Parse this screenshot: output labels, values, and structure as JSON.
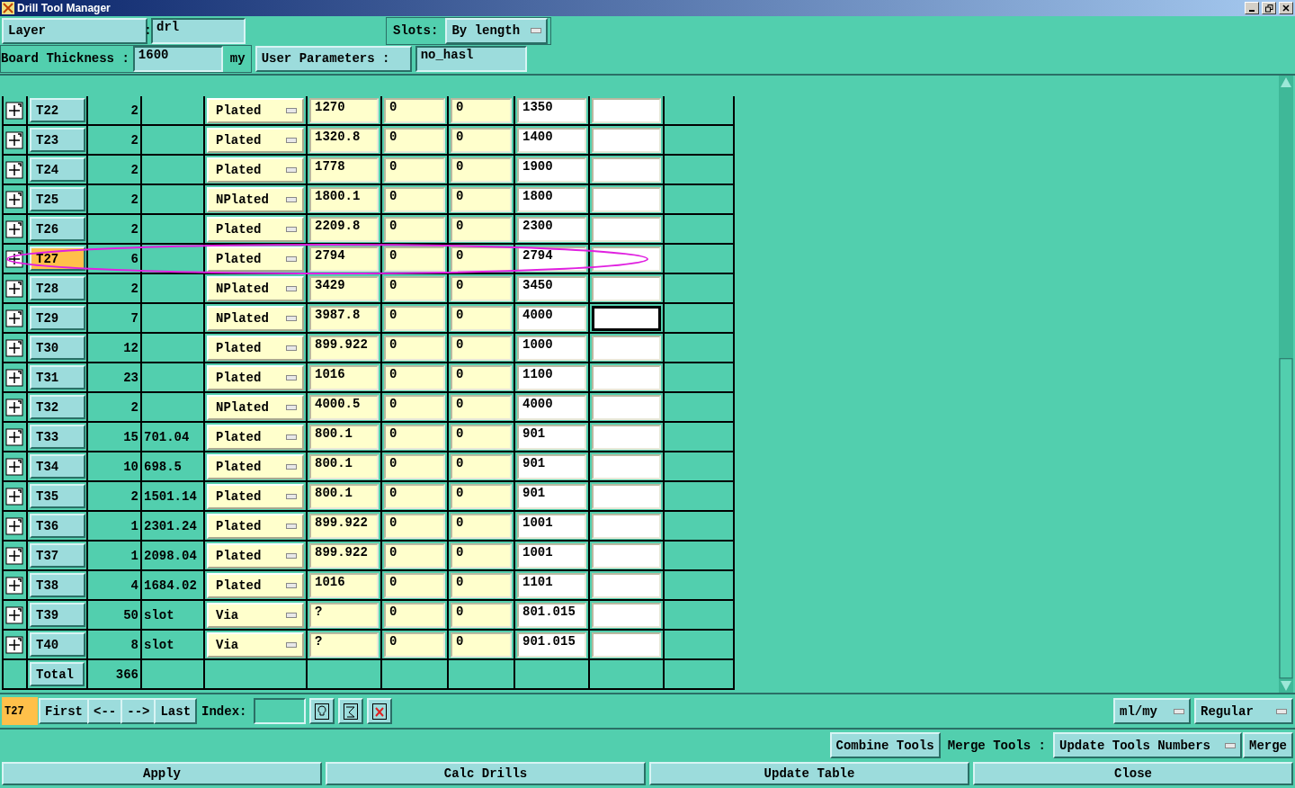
{
  "window": {
    "title": "Drill Tool Manager"
  },
  "header": {
    "layer_label": "Layer             :",
    "layer_value": "drl",
    "slots_label": "Slots:",
    "slots_value": "By length",
    "thickness_label": "Board Thickness :",
    "thickness_value": "1600",
    "thickness_unit": "my",
    "user_params_label": "User Parameters :",
    "user_params_value": "no_hasl"
  },
  "rows": [
    {
      "tool": "T22",
      "count": "2",
      "column_3": "",
      "type": "Plated",
      "column_5": "1270",
      "column_6": "0",
      "column_7": "0",
      "column_8": "1350",
      "selected": false,
      "focused": false,
      "circled": false
    },
    {
      "tool": "T23",
      "count": "2",
      "column_3": "",
      "type": "Plated",
      "column_5": "1320.8",
      "column_6": "0",
      "column_7": "0",
      "column_8": "1400",
      "selected": false,
      "focused": false,
      "circled": false
    },
    {
      "tool": "T24",
      "count": "2",
      "column_3": "",
      "type": "Plated",
      "column_5": "1778",
      "column_6": "0",
      "column_7": "0",
      "column_8": "1900",
      "selected": false,
      "focused": false,
      "circled": false
    },
    {
      "tool": "T25",
      "count": "2",
      "column_3": "",
      "type": "NPlated",
      "column_5": "1800.1",
      "column_6": "0",
      "column_7": "0",
      "column_8": "1800",
      "selected": false,
      "focused": false,
      "circled": false
    },
    {
      "tool": "T26",
      "count": "2",
      "column_3": "",
      "type": "Plated",
      "column_5": "2209.8",
      "column_6": "0",
      "column_7": "0",
      "column_8": "2300",
      "selected": false,
      "focused": false,
      "circled": false
    },
    {
      "tool": "T27",
      "count": "6",
      "column_3": "",
      "type": "Plated",
      "column_5": "2794",
      "column_6": "0",
      "column_7": "0",
      "column_8": "2794",
      "selected": true,
      "focused": false,
      "circled": true
    },
    {
      "tool": "T28",
      "count": "2",
      "column_3": "",
      "type": "NPlated",
      "column_5": "3429",
      "column_6": "0",
      "column_7": "0",
      "column_8": "3450",
      "selected": false,
      "focused": false,
      "circled": false
    },
    {
      "tool": "T29",
      "count": "7",
      "column_3": "",
      "type": "NPlated",
      "column_5": "3987.8",
      "column_6": "0",
      "column_7": "0",
      "column_8": "4000",
      "selected": false,
      "focused": true,
      "circled": false
    },
    {
      "tool": "T30",
      "count": "12",
      "column_3": "",
      "type": "Plated",
      "column_5": "899.922",
      "column_6": "0",
      "column_7": "0",
      "column_8": "1000",
      "selected": false,
      "focused": false,
      "circled": false
    },
    {
      "tool": "T31",
      "count": "23",
      "column_3": "",
      "type": "Plated",
      "column_5": "1016",
      "column_6": "0",
      "column_7": "0",
      "column_8": "1100",
      "selected": false,
      "focused": false,
      "circled": false
    },
    {
      "tool": "T32",
      "count": "2",
      "column_3": "",
      "type": "NPlated",
      "column_5": "4000.5",
      "column_6": "0",
      "column_7": "0",
      "column_8": "4000",
      "selected": false,
      "focused": false,
      "circled": false
    },
    {
      "tool": "T33",
      "count": "15",
      "column_3": "701.04",
      "type": "Plated",
      "column_5": "800.1",
      "column_6": "0",
      "column_7": "0",
      "column_8": "901",
      "selected": false,
      "focused": false,
      "circled": false
    },
    {
      "tool": "T34",
      "count": "10",
      "column_3": "698.5",
      "type": "Plated",
      "column_5": "800.1",
      "column_6": "0",
      "column_7": "0",
      "column_8": "901",
      "selected": false,
      "focused": false,
      "circled": false
    },
    {
      "tool": "T35",
      "count": "2",
      "column_3": "1501.14",
      "type": "Plated",
      "column_5": "800.1",
      "column_6": "0",
      "column_7": "0",
      "column_8": "901",
      "selected": false,
      "focused": false,
      "circled": false
    },
    {
      "tool": "T36",
      "count": "1",
      "column_3": "2301.24",
      "type": "Plated",
      "column_5": "899.922",
      "column_6": "0",
      "column_7": "0",
      "column_8": "1001",
      "selected": false,
      "focused": false,
      "circled": false
    },
    {
      "tool": "T37",
      "count": "1",
      "column_3": "2098.04",
      "type": "Plated",
      "column_5": "899.922",
      "column_6": "0",
      "column_7": "0",
      "column_8": "1001",
      "selected": false,
      "focused": false,
      "circled": false
    },
    {
      "tool": "T38",
      "count": "4",
      "column_3": "1684.02",
      "type": "Plated",
      "column_5": "1016",
      "column_6": "0",
      "column_7": "0",
      "column_8": "1101",
      "selected": false,
      "focused": false,
      "circled": false
    },
    {
      "tool": "T39",
      "count": "50",
      "column_3": "slot",
      "type": "Via",
      "column_5": "?",
      "column_6": "0",
      "column_7": "0",
      "column_8": "801.015",
      "selected": false,
      "focused": false,
      "circled": false
    },
    {
      "tool": "T40",
      "count": "8",
      "column_3": "slot",
      "type": "Via",
      "column_5": "?",
      "column_6": "0",
      "column_7": "0",
      "column_8": "901.015",
      "selected": false,
      "focused": false,
      "circled": false
    }
  ],
  "total": {
    "label": "Total",
    "count": "366"
  },
  "navigator": {
    "current": "T27",
    "buttons": [
      "First",
      "<--",
      "-->",
      "Last"
    ],
    "index_label": "Index:",
    "units": "ml/my",
    "mode": "Regular"
  },
  "merge": {
    "combine": "Combine Tools",
    "label": "Merge Tools :",
    "option": "Update Tools Numbers",
    "merge": "Merge"
  },
  "actions": [
    "Apply",
    "Calc Drills",
    "Update Table",
    "Close"
  ]
}
